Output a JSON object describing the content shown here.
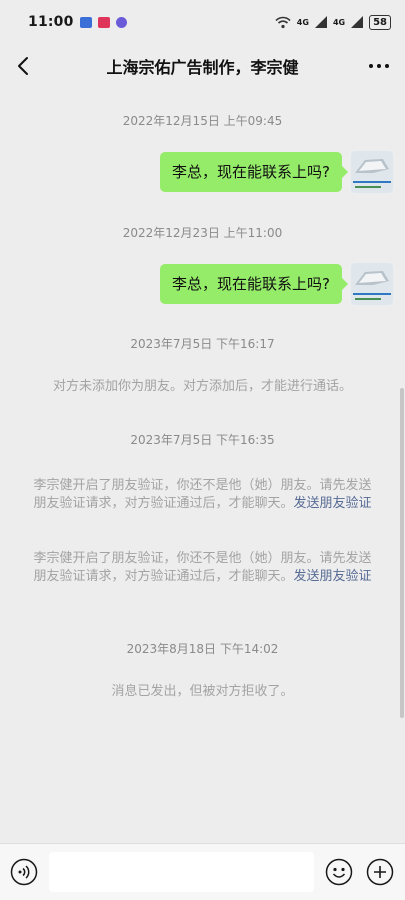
{
  "status_bar": {
    "time": "11:00",
    "signal_1": "4G",
    "signal_2": "4G",
    "battery": "58",
    "icons": [
      "video-app-icon",
      "media-app-icon",
      "music-app-icon",
      "wifi-icon",
      "signal-icon",
      "signal-icon",
      "battery-icon"
    ]
  },
  "header": {
    "title": "上海宗佑广告制作，李宗健",
    "back_icon": "chevron-left-icon",
    "more_icon": "more-dots-icon"
  },
  "messages": [
    {
      "type": "timestamp",
      "text": "2022年12月15日 上午09:45"
    },
    {
      "type": "sent",
      "text": "李总，现在能联系上吗?"
    },
    {
      "type": "timestamp",
      "text": "2022年12月23日 上午11:00"
    },
    {
      "type": "sent",
      "text": "李总，现在能联系上吗?"
    },
    {
      "type": "timestamp",
      "text": "2023年7月5日 下午16:17"
    },
    {
      "type": "system",
      "text": "对方未添加你为朋友。对方添加后，才能进行通话。"
    },
    {
      "type": "timestamp",
      "text": "2023年7月5日 下午16:35"
    },
    {
      "type": "system",
      "text": "李宗健开启了朋友验证，你还不是他（她）朋友。请先发送朋友验证请求，对方验证通过后，才能聊天。",
      "link": "发送朋友验证"
    },
    {
      "type": "system",
      "text": "李宗健开启了朋友验证，你还不是他（她）朋友。请先发送朋友验证请求，对方验证通过后，才能聊天。",
      "link": "发送朋友验证"
    },
    {
      "type": "timestamp",
      "text": "2023年8月18日 下午14:02"
    },
    {
      "type": "system",
      "text": "消息已发出，但被对方拒收了。"
    }
  ],
  "input_bar": {
    "voice_icon": "voice-icon",
    "input_value": "",
    "emoji_icon": "emoji-icon",
    "plus_icon": "plus-icon"
  },
  "colors": {
    "background": "#ededed",
    "sent_bubble": "#95ec69",
    "link": "#576b95",
    "timestamp": "#8a8a8a",
    "system_text": "#a3a3a3"
  }
}
